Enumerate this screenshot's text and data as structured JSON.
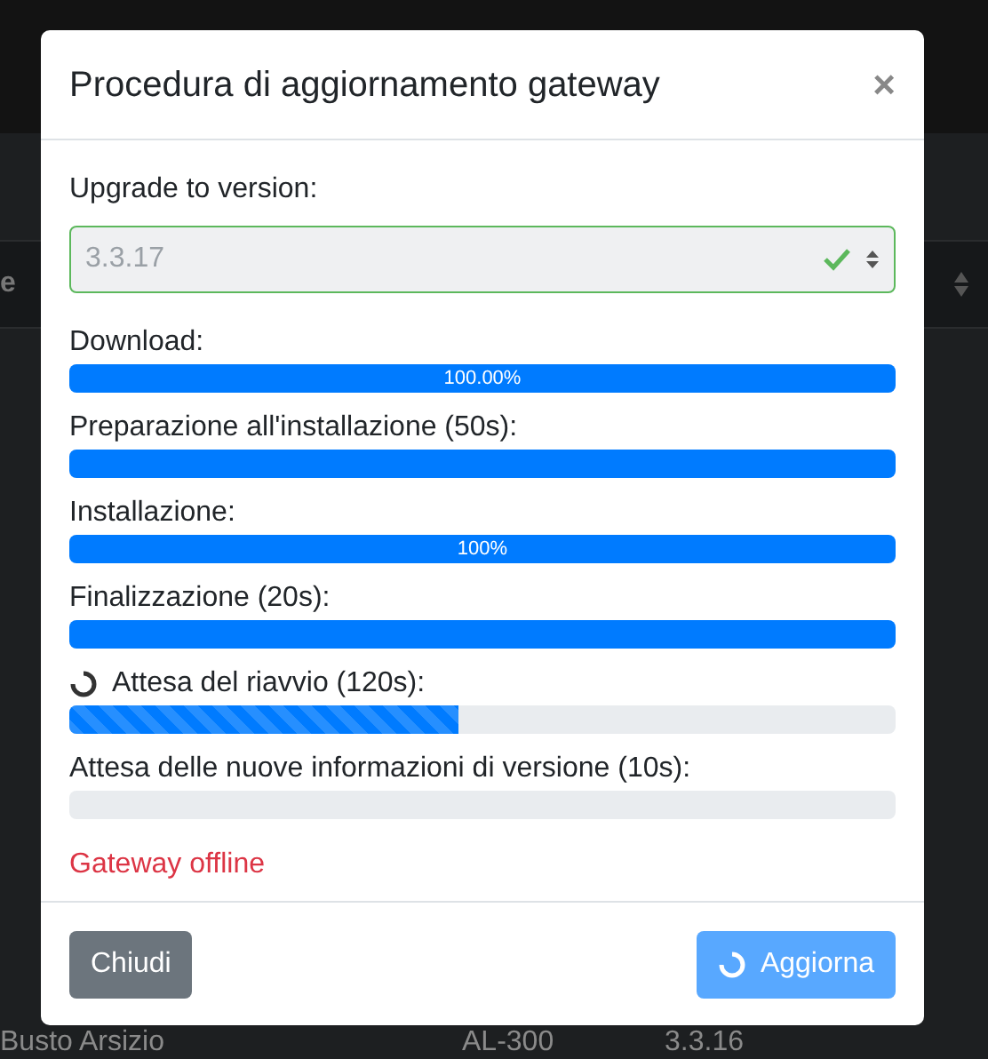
{
  "background": {
    "column_1": "e",
    "row": {
      "city": "Busto Arsizio",
      "model": "AL-300",
      "version": "3.3.16"
    }
  },
  "modal": {
    "title": "Procedura di aggiornamento gateway",
    "close": "×",
    "version_label": "Upgrade to version:",
    "version_value": "3.3.17",
    "version_valid": true,
    "steps": [
      {
        "label": "Download:",
        "level": 1,
        "bar_text": "100.00%",
        "striped": false,
        "spinner": false
      },
      {
        "label": "Preparazione all'installazione (50s):",
        "level": 1,
        "striped": false,
        "spinner": false
      },
      {
        "label": "Installazione:",
        "level": 1,
        "bar_text": "100%",
        "striped": false,
        "spinner": false
      },
      {
        "label": "Finalizzazione (20s):",
        "level": 1,
        "striped": false,
        "spinner": false
      },
      {
        "label": "Attesa del riavvio (120s):",
        "level": 0.47,
        "striped": true,
        "spinner": true
      },
      {
        "label": "Attesa delle nuove informazioni di versione (10s):",
        "level": 0,
        "spinner": false
      }
    ],
    "error": "Gateway offline",
    "buttons": [
      {
        "label": "Chiudi",
        "kind": "secondary",
        "disabled": false,
        "spinner": false
      },
      {
        "label": "Aggiorna",
        "kind": "primary",
        "disabled": true,
        "spinner": true
      }
    ]
  }
}
